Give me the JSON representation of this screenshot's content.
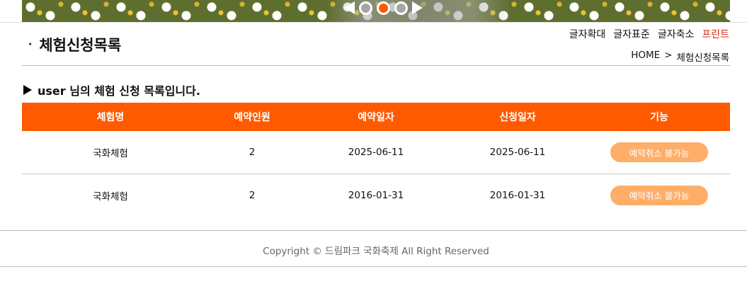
{
  "banner": {
    "prev_icon": "triangle-left",
    "next_icon": "triangle-right",
    "dots": [
      {
        "state": "inactive"
      },
      {
        "state": "active"
      },
      {
        "state": "inactive"
      }
    ],
    "accent_color": "#ff5a00"
  },
  "header": {
    "title_bullet": "·",
    "title": "체험신청목록",
    "font_tools": {
      "enlarge": "글자확대",
      "standard": "글자표준",
      "shrink": "글자축소",
      "print": "프린트"
    },
    "breadcrumb": {
      "home": "HOME",
      "separator": ">",
      "current": "체험신청목록"
    }
  },
  "list": {
    "heading": "user 님의 체험 신청 목록입니다.",
    "columns": [
      "체험명",
      "예약인원",
      "예약일자",
      "신청일자",
      "기능"
    ],
    "rows": [
      {
        "name": "국화체험",
        "people": "2",
        "reserve_date": "2025-06-11",
        "apply_date": "2025-06-11",
        "action": "예약취소 불가능"
      },
      {
        "name": "국화체험",
        "people": "2",
        "reserve_date": "2016-01-31",
        "apply_date": "2016-01-31",
        "action": "예약취소 불가능"
      }
    ],
    "header_color": "#ff5a00",
    "button_color": "#ffae6a"
  },
  "footer": {
    "copyright": "Copyright © 드림파크 국화축제 All Right Reserved"
  }
}
